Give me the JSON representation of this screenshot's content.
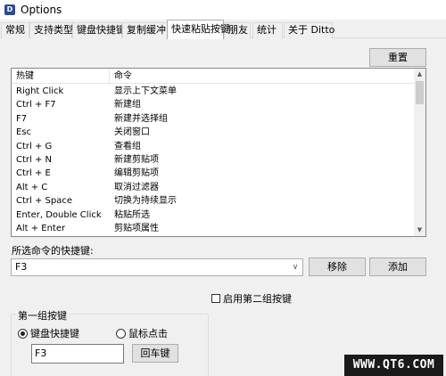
{
  "window": {
    "title": "Options",
    "icon": "ditto-app-icon"
  },
  "tabs": [
    {
      "label": "常规",
      "active": false
    },
    {
      "label": "支持类型",
      "active": false
    },
    {
      "label": "键盘快捷键",
      "active": false
    },
    {
      "label": "复制缓冲区",
      "active": false
    },
    {
      "label": "快速粘贴按键",
      "active": true
    },
    {
      "label": "朋友",
      "active": false
    },
    {
      "label": "统计",
      "active": false
    },
    {
      "label": "关于 Ditto",
      "active": false
    }
  ],
  "reset_button": "重置",
  "hotkey_list": {
    "columns": [
      "热键",
      "命令"
    ],
    "rows": [
      [
        "Right Click",
        "显示上下文菜单"
      ],
      [
        "Ctrl + F7",
        "新建组"
      ],
      [
        "F7",
        "新建并选择组"
      ],
      [
        "Esc",
        "关闭窗口"
      ],
      [
        "Ctrl + G",
        "查看组"
      ],
      [
        "Ctrl + N",
        "新建剪贴项"
      ],
      [
        "Ctrl + E",
        "编辑剪贴项"
      ],
      [
        "Alt + C",
        "取消过滤器"
      ],
      [
        "Ctrl + Space",
        "切换为持续显示"
      ],
      [
        "Enter, Double Click",
        "粘贴所选"
      ],
      [
        "Alt + Enter",
        "剪贴项属性"
      ]
    ]
  },
  "selected_command": {
    "label": "所选命令的快捷键:",
    "value": "F3",
    "remove_button": "移除",
    "add_button": "添加"
  },
  "second_hotkey": {
    "label": "启用第二组按键",
    "checked": false
  },
  "first_group": {
    "title": "第一组按键",
    "radio_keyboard": "键盘快捷键",
    "radio_mouse": "鼠标点击",
    "selected": "keyboard",
    "hotkey_value": "F3",
    "enter_button": "回车键"
  },
  "watermark": "WWW.QT6.COM"
}
